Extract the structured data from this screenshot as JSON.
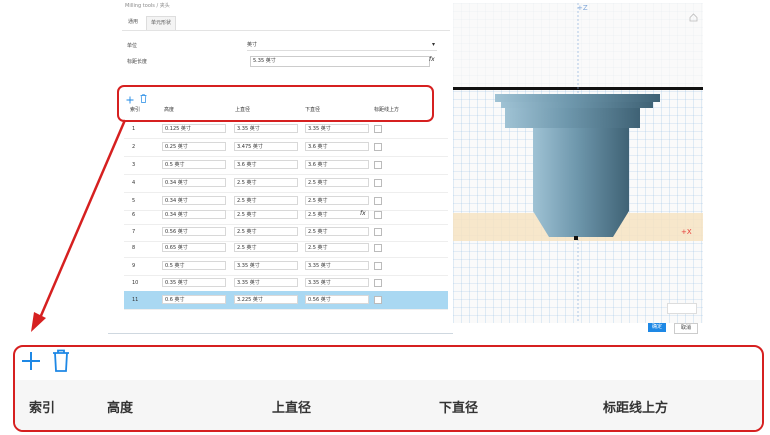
{
  "breadcrumb": {
    "parent": "Milling tools",
    "sep": "/",
    "current": "夹头"
  },
  "tabs": [
    {
      "label": "通用"
    },
    {
      "label": "单元形状"
    }
  ],
  "form": {
    "type_label": "单位",
    "type_value": "英寸",
    "gauge_label": "标距长度",
    "gauge_value": "5.35 英寸"
  },
  "toolbar": {
    "add_icon": "plus-icon",
    "delete_icon": "trash-icon"
  },
  "table": {
    "headers": [
      "索引",
      "高度",
      "上直径",
      "下直径",
      "标距线上方"
    ],
    "rows": [
      {
        "index": "1",
        "height": "0.125 英寸",
        "upper": "3.35 英寸",
        "lower": "3.35 英寸"
      },
      {
        "index": "2",
        "height": "0.25 英寸",
        "upper": "3.475 英寸",
        "lower": "3.6 英寸"
      },
      {
        "index": "3",
        "height": "0.5 英寸",
        "upper": "3.6 英寸",
        "lower": "3.6 英寸"
      },
      {
        "index": "4",
        "height": "0.34 英寸",
        "upper": "2.5 英寸",
        "lower": "2.5 英寸"
      },
      {
        "index": "5",
        "height": "0.34 英寸",
        "upper": "2.5 英寸",
        "lower": "2.5 英寸"
      },
      {
        "index": "6",
        "height": "0.34 英寸",
        "upper": "2.5 英寸",
        "lower": "2.5 英寸"
      },
      {
        "index": "7",
        "height": "0.56 英寸",
        "upper": "2.5 英寸",
        "lower": "2.5 英寸"
      },
      {
        "index": "8",
        "height": "0.65 英寸",
        "upper": "2.5 英寸",
        "lower": "2.5 英寸"
      },
      {
        "index": "9",
        "height": "0.5 英寸",
        "upper": "3.35 英寸",
        "lower": "3.35 英寸"
      },
      {
        "index": "10",
        "height": "0.35 英寸",
        "upper": "3.35 英寸",
        "lower": "3.35 英寸"
      },
      {
        "index": "11",
        "height": "0.6 英寸",
        "upper": "3.225 英寸",
        "lower": "0.56 英寸"
      }
    ]
  },
  "viewport": {
    "z_label": "+Z",
    "x_label": "+X"
  },
  "buttons": {
    "ok": "确定",
    "cancel": "取消"
  },
  "colors": {
    "accent": "#1e88e5",
    "highlight": "#d62020",
    "selected_row": "#a9d8f2"
  }
}
